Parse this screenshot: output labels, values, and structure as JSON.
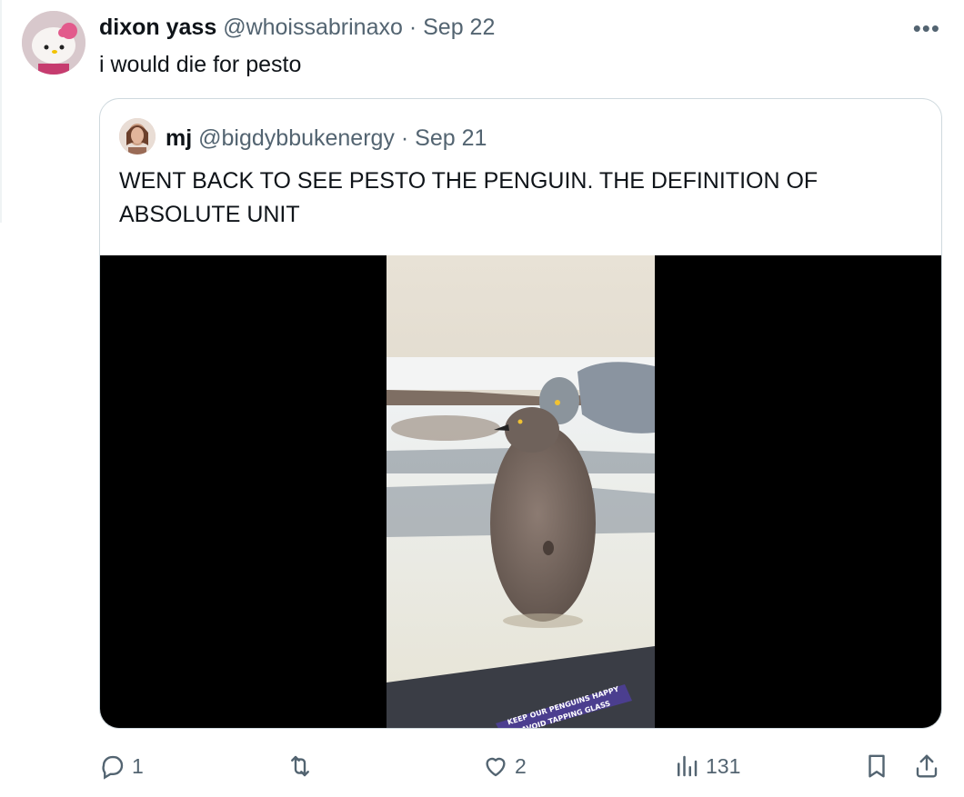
{
  "tweet": {
    "author_name": "dixon yass",
    "author_handle": "@whoissabrinaxo",
    "date": "· Sep 22",
    "more_icon": "more-horizontal-icon",
    "text": "i would die for pesto"
  },
  "quoted": {
    "author_name": "mj",
    "author_handle": "@bigdybbukenergy",
    "date": "· Sep 21",
    "text": "WENT BACK TO SEE PESTO THE PENGUIN. THE DEFINITION OF ABSOLUTE UNIT",
    "media": {
      "sign_line1": "KEEP OUR PENGUINS HAPPY",
      "sign_line2": "AVOID TAPPING GLASS"
    }
  },
  "actions": {
    "replies": "1",
    "reposts": "",
    "likes": "2",
    "views": "131"
  },
  "colors": {
    "muted": "#536471",
    "border": "#cfd9de",
    "text": "#0f1419"
  }
}
